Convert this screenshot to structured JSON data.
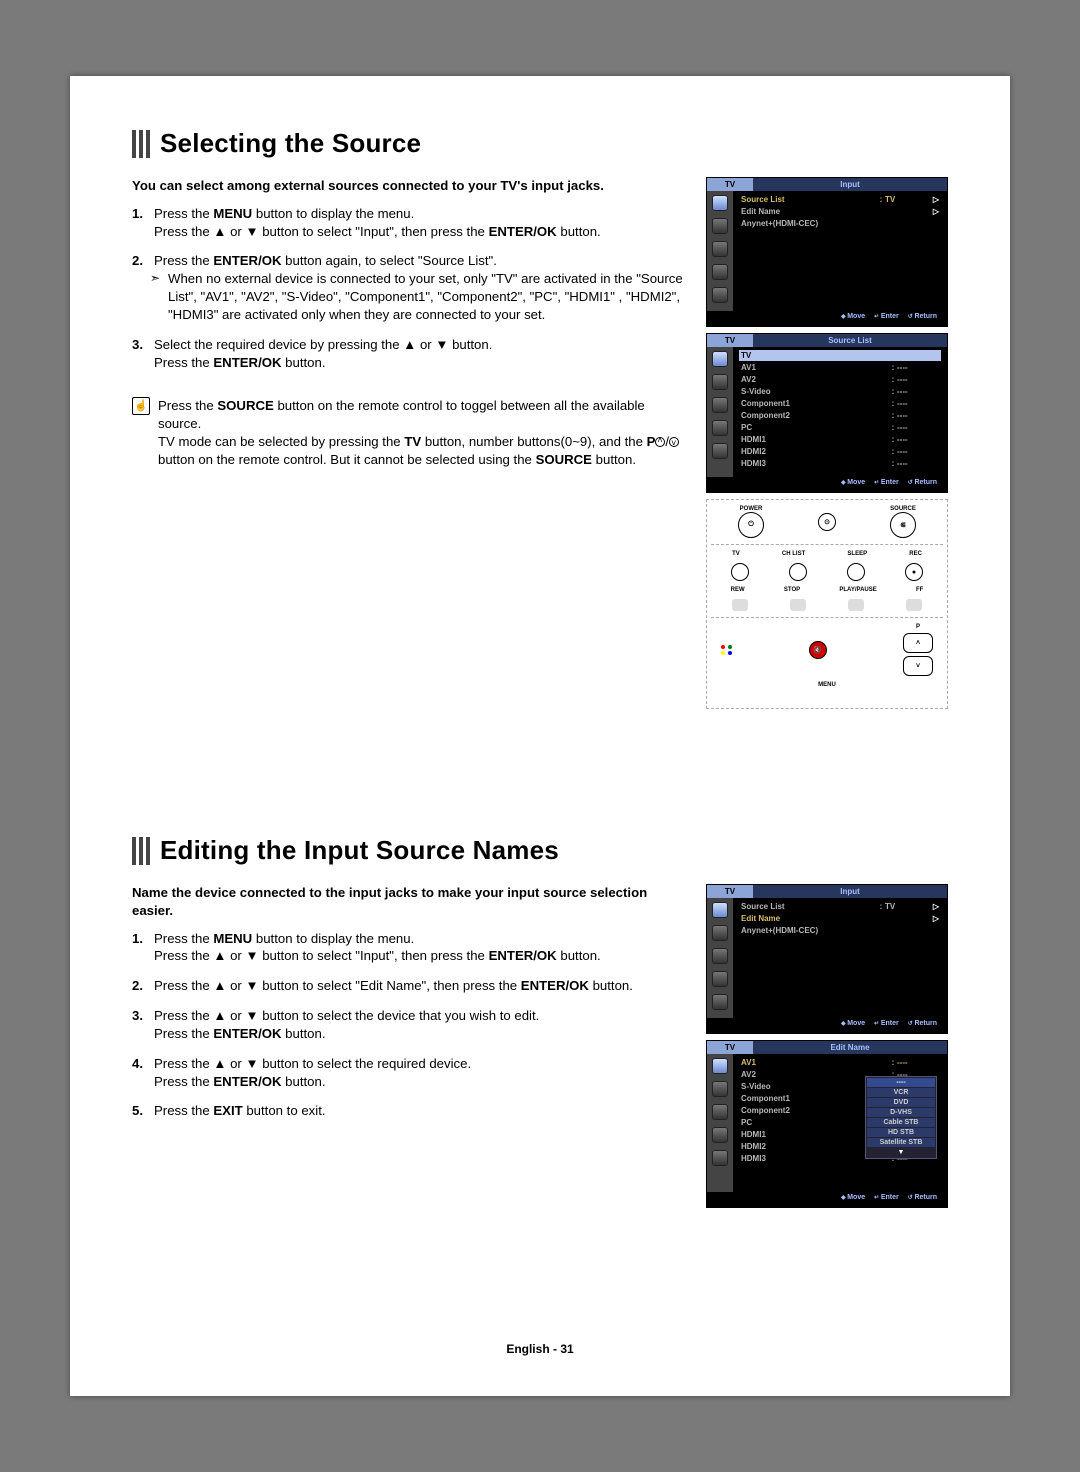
{
  "section1": {
    "title": "Selecting the Source",
    "intro": "You can select among external sources connected to your TV's input jacks.",
    "step1a": "Press the ",
    "step1a_b": "MENU",
    "step1a2": " button to display the menu.",
    "step1b": "Press the ▲ or ▼ button to select \"Input\", then press the ",
    "step1b_b": "ENTER/OK",
    "step1b2": " button.",
    "step2a": "Press the ",
    "step2a_b": "ENTER/OK",
    "step2a2": " button again, to select \"Source List\".",
    "step2sub": "When no external device is connected to your set, only \"TV\" are activated in the \"Source List\", \"AV1\", \"AV2\", \"S-Video\", \"Component1\", \"Component2\", \"PC\", \"HDMI1\" , \"HDMI2\", \"HDMI3\" are activated only when they are connected to your set.",
    "step3a": "Select the required device by pressing the ▲ or ▼ button.",
    "step3b": "Press the ",
    "step3b_b": "ENTER/OK",
    "step3b2": " button.",
    "note_a": "Press the ",
    "note_a_b": "SOURCE",
    "note_a2": " button on the remote control to toggel between all the available source.",
    "note_b": "TV mode can be selected by pressing the ",
    "note_b_b": "TV",
    "note_b2": " button, number buttons(0~9), and the ",
    "note_b3": "P",
    "note_b4": " button on the remote control. But it cannot be selected using the ",
    "note_b_b2": "SOURCE",
    "note_b5": " button."
  },
  "section2": {
    "title": "Editing the Input Source Names",
    "intro": "Name the device connected to the input jacks to make your input source selection easier.",
    "s1a": "Press the ",
    "s1a_b": "MENU",
    "s1a2": " button to display the menu.",
    "s1b": "Press the ▲ or ▼ button to select \"Input\", then press the ",
    "s1b_b": "ENTER/OK",
    "s1b2": " button.",
    "s2": "Press the ▲ or ▼ button to select \"Edit Name\", then press the ",
    "s2_b": "ENTER/OK",
    "s2_2": " button.",
    "s3a": "Press the ▲ or ▼ button to select the device that you wish to edit.",
    "s3b": "Press the ",
    "s3b_b": "ENTER/OK",
    "s3b2": " button.",
    "s4a": "Press the ▲ or ▼ button to select the required device.",
    "s4b": "Press the ",
    "s4b_b": "ENTER/OK",
    "s4b2": " button.",
    "s5a": "Press the ",
    "s5a_b": "EXIT",
    "s5a2": " button to exit."
  },
  "osd": {
    "tv": "TV",
    "input": "Input",
    "source_list": "Source List",
    "edit_name": "Edit Name",
    "anynet": "Anynet+(HDMI-CEC)",
    "move": "Move",
    "enter": "Enter",
    "return": "Return",
    "col": ":",
    "dash": "----",
    "sources": [
      "TV",
      "AV1",
      "AV2",
      "S-Video",
      "Component1",
      "Component2",
      "PC",
      "HDMI1",
      "HDMI2",
      "HDMI3"
    ],
    "editrows": [
      "AV1",
      "AV2",
      "S-Video",
      "Component1",
      "Component2",
      "PC",
      "HDMI1",
      "HDMI2",
      "HDMI3"
    ],
    "popup": [
      "----",
      "VCR",
      "DVD",
      "D-VHS",
      "Cable STB",
      "HD STB",
      "Satellite STB"
    ],
    "tri": "▼"
  },
  "remote": {
    "power": "POWER",
    "source": "SOURCE",
    "tv": "TV",
    "chlist": "CH LIST",
    "sleep": "SLEEP",
    "rec": "REC",
    "rew": "REW",
    "stop": "STOP",
    "play": "PLAY/PAUSE",
    "ff": "FF",
    "menu": "MENU",
    "p": "P"
  },
  "footer": "English - 31"
}
